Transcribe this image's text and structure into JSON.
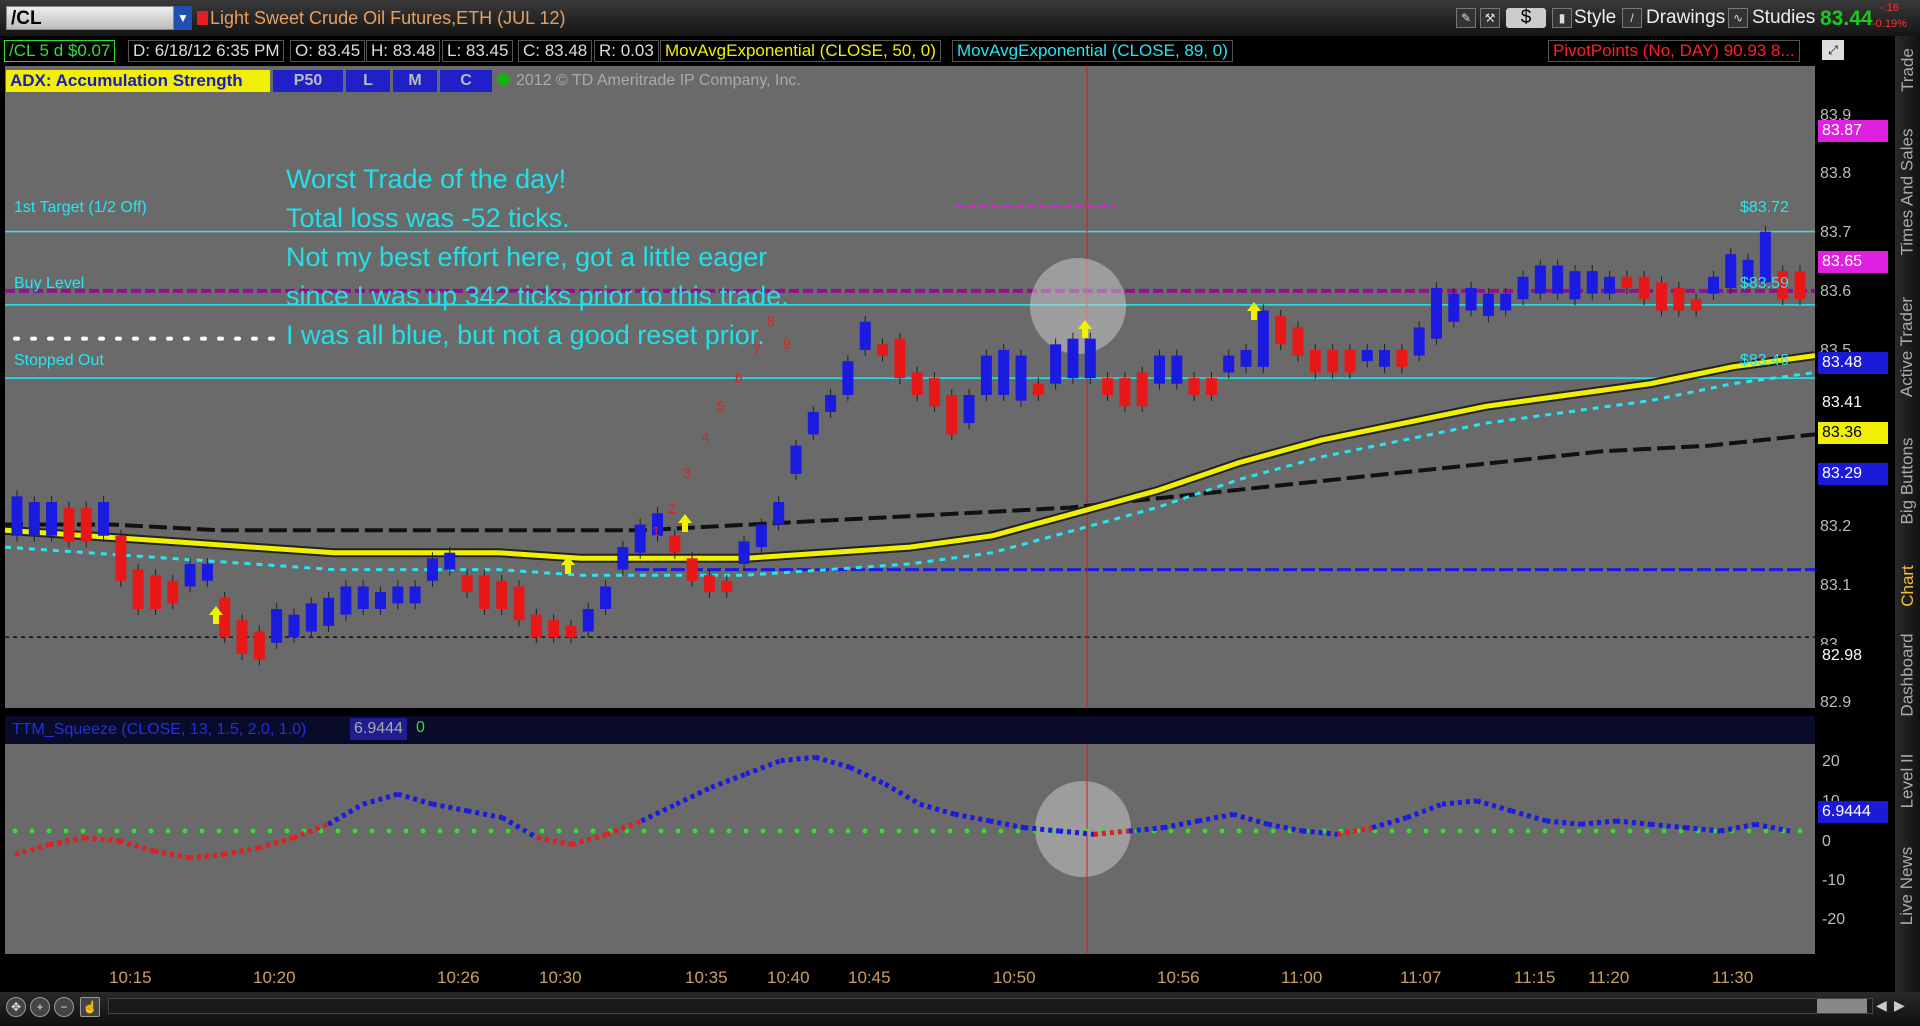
{
  "toolbar": {
    "symbol": "/CL",
    "instrument_title": "Light Sweet Crude Oil Futures,ETH (JUL 12)",
    "dollar_label": "$",
    "style_label": "Style",
    "drawings_label": "Drawings",
    "studies_label": "Studies",
    "last_price": "83.44",
    "net_change": "-.16",
    "pct_change": "-0.19%"
  },
  "infobar": {
    "aggregation": "/CL 5 d $0.07",
    "datetime": "D: 6/18/12 6:35 PM",
    "open": "O: 83.45",
    "high": "H: 83.48",
    "low": "L: 83.45",
    "close": "C: 83.48",
    "range": "R: 0.03",
    "ema50": "MovAvgExponential (CLOSE, 50, 0)",
    "ema89": "MovAvgExponential (CLOSE, 89, 0)",
    "pivots": "PivotPoints (No, DAY)",
    "pivots_val": "90.93",
    "pivots_more": "8..."
  },
  "study_bar": {
    "adx": "ADX:  Accumulation Strength",
    "buttons": [
      "P50",
      "L",
      "M",
      "C"
    ],
    "copyright": "2012 © TD Ameritrade IP Company, Inc."
  },
  "annotation": {
    "lines": [
      "Worst Trade of the day!",
      "Total loss was -52 ticks.",
      "Not my best effort here, got a little eager",
      "since I was up 342 ticks prior to this trade.",
      "I was all blue, but not a good reset prior."
    ]
  },
  "levels": {
    "target": "1st Target (1/2 Off)",
    "buy": "Buy Level",
    "stopped": "Stopped Out",
    "target_price": "$83.72",
    "buy_price": "$83.59",
    "stop_price": "$83.46"
  },
  "price_axis": {
    "ticks": [
      "83.9",
      "83.8",
      "83.7",
      "83.6",
      "83.5",
      "83.2",
      "83.1",
      "83",
      "82.9"
    ],
    "labels": [
      {
        "text": "83.87",
        "bg": "#e020e0",
        "fg": "#ffffff"
      },
      {
        "text": "83.65",
        "bg": "#e020e0",
        "fg": "#ffffff"
      },
      {
        "text": "83.48",
        "bg": "#1a1ad8",
        "fg": "#ffffff"
      },
      {
        "text": "83.41",
        "bg": "#000000",
        "fg": "#ffffff"
      },
      {
        "text": "83.36",
        "bg": "#f0f000",
        "fg": "#000000"
      },
      {
        "text": "83.29",
        "bg": "#1a1ad8",
        "fg": "#ffffff"
      },
      {
        "text": "82.98",
        "bg": "#000000",
        "fg": "#ffffff"
      }
    ]
  },
  "ttm": {
    "label": "TTM_Squeeze (CLOSE, 13, 1.5, 2.0, 1.0)",
    "value": "6.9444",
    "signal": "0",
    "ticks": [
      "20",
      "10",
      "0",
      "-10",
      "-20"
    ],
    "axis_label": "6.9444"
  },
  "time_axis": [
    "10:15",
    "10:20",
    "10:26",
    "10:30",
    "10:35",
    "10:40",
    "10:45",
    "10:50",
    "10:56",
    "11:00",
    "11:07",
    "11:15",
    "11:20",
    "11:30"
  ],
  "sidebar_tabs": [
    "Trade",
    "Times And Sales",
    "Active Trader",
    "Big Buttons",
    "Chart",
    "Dashboard",
    "Level II",
    "Live News"
  ],
  "bar_counts": [
    "1",
    "2",
    "3",
    "4",
    "5",
    "6",
    "7",
    "8",
    "9"
  ],
  "colors": {
    "up": "#1a1ae0",
    "down": "#e81818",
    "ema50": "#f0f000",
    "accent": "#26e6f2"
  },
  "chart_data": {
    "type": "candlestick",
    "title": "Light Sweet Crude Oil Futures,ETH (JUL 12)",
    "ylim": [
      82.86,
      84.0
    ],
    "y_ticks": [
      82.9,
      83.0,
      83.1,
      83.2,
      83.5,
      83.6,
      83.7,
      83.8,
      83.9
    ],
    "x_ticks": [
      "10:15",
      "10:20",
      "10:26",
      "10:30",
      "10:35",
      "10:40",
      "10:45",
      "10:50",
      "10:56",
      "11:00",
      "11:07",
      "11:15",
      "11:20",
      "11:30"
    ],
    "candles": [
      {
        "o": 83.25,
        "c": 83.18,
        "d": "u"
      },
      {
        "o": 83.24,
        "c": 83.18,
        "d": "u"
      },
      {
        "o": 83.24,
        "c": 83.18,
        "d": "u"
      },
      {
        "o": 83.23,
        "c": 83.17,
        "d": "d"
      },
      {
        "o": 83.23,
        "c": 83.17,
        "d": "d"
      },
      {
        "o": 83.24,
        "c": 83.18,
        "d": "u"
      },
      {
        "o": 83.18,
        "c": 83.1,
        "d": "d"
      },
      {
        "o": 83.12,
        "c": 83.05,
        "d": "d"
      },
      {
        "o": 83.11,
        "c": 83.05,
        "d": "d"
      },
      {
        "o": 83.1,
        "c": 83.06,
        "d": "d"
      },
      {
        "o": 83.13,
        "c": 83.09,
        "d": "u"
      },
      {
        "o": 83.13,
        "c": 83.1,
        "d": "u"
      },
      {
        "o": 83.07,
        "c": 83.0,
        "d": "d"
      },
      {
        "o": 83.03,
        "c": 82.97,
        "d": "d"
      },
      {
        "o": 83.01,
        "c": 82.96,
        "d": "d"
      },
      {
        "o": 82.99,
        "c": 83.05,
        "d": "u"
      },
      {
        "o": 83.0,
        "c": 83.04,
        "d": "u"
      },
      {
        "o": 83.01,
        "c": 83.06,
        "d": "u"
      },
      {
        "o": 83.02,
        "c": 83.07,
        "d": "u"
      },
      {
        "o": 83.04,
        "c": 83.09,
        "d": "u"
      },
      {
        "o": 83.05,
        "c": 83.09,
        "d": "u"
      },
      {
        "o": 83.05,
        "c": 83.08,
        "d": "u"
      },
      {
        "o": 83.06,
        "c": 83.09,
        "d": "u"
      },
      {
        "o": 83.06,
        "c": 83.09,
        "d": "u"
      },
      {
        "o": 83.1,
        "c": 83.14,
        "d": "u"
      },
      {
        "o": 83.12,
        "c": 83.15,
        "d": "u"
      },
      {
        "o": 83.11,
        "c": 83.08,
        "d": "d"
      },
      {
        "o": 83.11,
        "c": 83.05,
        "d": "d"
      },
      {
        "o": 83.1,
        "c": 83.05,
        "d": "d"
      },
      {
        "o": 83.09,
        "c": 83.03,
        "d": "d"
      },
      {
        "o": 83.04,
        "c": 83.0,
        "d": "d"
      },
      {
        "o": 83.03,
        "c": 83.0,
        "d": "d"
      },
      {
        "o": 83.02,
        "c": 83.0,
        "d": "d"
      },
      {
        "o": 83.01,
        "c": 83.05,
        "d": "u"
      },
      {
        "o": 83.05,
        "c": 83.09,
        "d": "u"
      },
      {
        "o": 83.12,
        "c": 83.16,
        "d": "u"
      },
      {
        "o": 83.15,
        "c": 83.2,
        "d": "u"
      },
      {
        "o": 83.18,
        "c": 83.22,
        "d": "u"
      },
      {
        "o": 83.18,
        "c": 83.15,
        "d": "d"
      },
      {
        "o": 83.14,
        "c": 83.1,
        "d": "d"
      },
      {
        "o": 83.11,
        "c": 83.08,
        "d": "d"
      },
      {
        "o": 83.1,
        "c": 83.08,
        "d": "d"
      },
      {
        "o": 83.13,
        "c": 83.17,
        "d": "u"
      },
      {
        "o": 83.16,
        "c": 83.2,
        "d": "u"
      },
      {
        "o": 83.2,
        "c": 83.24,
        "d": "u"
      },
      {
        "o": 83.29,
        "c": 83.34,
        "d": "u"
      },
      {
        "o": 83.36,
        "c": 83.4,
        "d": "u"
      },
      {
        "o": 83.4,
        "c": 83.43,
        "d": "u"
      },
      {
        "o": 83.43,
        "c": 83.49,
        "d": "u"
      },
      {
        "o": 83.51,
        "c": 83.56,
        "d": "u"
      },
      {
        "o": 83.52,
        "c": 83.5,
        "d": "d"
      },
      {
        "o": 83.53,
        "c": 83.46,
        "d": "d"
      },
      {
        "o": 83.47,
        "c": 83.43,
        "d": "d"
      },
      {
        "o": 83.46,
        "c": 83.41,
        "d": "d"
      },
      {
        "o": 83.43,
        "c": 83.36,
        "d": "d"
      },
      {
        "o": 83.43,
        "c": 83.38,
        "d": "u"
      },
      {
        "o": 83.43,
        "c": 83.5,
        "d": "u"
      },
      {
        "o": 83.43,
        "c": 83.51,
        "d": "u"
      },
      {
        "o": 83.42,
        "c": 83.5,
        "d": "u"
      },
      {
        "o": 83.45,
        "c": 83.43,
        "d": "d"
      },
      {
        "o": 83.45,
        "c": 83.52,
        "d": "u"
      },
      {
        "o": 83.46,
        "c": 83.53,
        "d": "u"
      },
      {
        "o": 83.46,
        "c": 83.53,
        "d": "u"
      },
      {
        "o": 83.46,
        "c": 83.43,
        "d": "d"
      },
      {
        "o": 83.46,
        "c": 83.41,
        "d": "d"
      },
      {
        "o": 83.47,
        "c": 83.41,
        "d": "d"
      },
      {
        "o": 83.45,
        "c": 83.5,
        "d": "u"
      },
      {
        "o": 83.45,
        "c": 83.5,
        "d": "u"
      },
      {
        "o": 83.46,
        "c": 83.43,
        "d": "d"
      },
      {
        "o": 83.46,
        "c": 83.43,
        "d": "d"
      },
      {
        "o": 83.47,
        "c": 83.5,
        "d": "u"
      },
      {
        "o": 83.48,
        "c": 83.51,
        "d": "u"
      },
      {
        "o": 83.48,
        "c": 83.58,
        "d": "u"
      },
      {
        "o": 83.57,
        "c": 83.52,
        "d": "d"
      },
      {
        "o": 83.55,
        "c": 83.5,
        "d": "d"
      },
      {
        "o": 83.51,
        "c": 83.47,
        "d": "d"
      },
      {
        "o": 83.51,
        "c": 83.47,
        "d": "d"
      },
      {
        "o": 83.51,
        "c": 83.47,
        "d": "d"
      },
      {
        "o": 83.49,
        "c": 83.51,
        "d": "u"
      },
      {
        "o": 83.48,
        "c": 83.51,
        "d": "u"
      },
      {
        "o": 83.51,
        "c": 83.48,
        "d": "d"
      },
      {
        "o": 83.5,
        "c": 83.55,
        "d": "u"
      },
      {
        "o": 83.53,
        "c": 83.62,
        "d": "u"
      },
      {
        "o": 83.56,
        "c": 83.61,
        "d": "u"
      },
      {
        "o": 83.58,
        "c": 83.62,
        "d": "u"
      },
      {
        "o": 83.57,
        "c": 83.61,
        "d": "u"
      },
      {
        "o": 83.58,
        "c": 83.61,
        "d": "u"
      },
      {
        "o": 83.6,
        "c": 83.64,
        "d": "u"
      },
      {
        "o": 83.61,
        "c": 83.66,
        "d": "u"
      },
      {
        "o": 83.61,
        "c": 83.66,
        "d": "u"
      },
      {
        "o": 83.6,
        "c": 83.65,
        "d": "u"
      },
      {
        "o": 83.61,
        "c": 83.65,
        "d": "u"
      },
      {
        "o": 83.61,
        "c": 83.64,
        "d": "u"
      },
      {
        "o": 83.64,
        "c": 83.62,
        "d": "d"
      },
      {
        "o": 83.64,
        "c": 83.6,
        "d": "d"
      },
      {
        "o": 83.63,
        "c": 83.58,
        "d": "d"
      },
      {
        "o": 83.62,
        "c": 83.58,
        "d": "d"
      },
      {
        "o": 83.6,
        "c": 83.58,
        "d": "d"
      },
      {
        "o": 83.61,
        "c": 83.64,
        "d": "u"
      },
      {
        "o": 83.62,
        "c": 83.68,
        "d": "u"
      },
      {
        "o": 83.63,
        "c": 83.67,
        "d": "u"
      },
      {
        "o": 83.63,
        "c": 83.72,
        "d": "u"
      },
      {
        "o": 83.65,
        "c": 83.6,
        "d": "d"
      },
      {
        "o": 83.65,
        "c": 83.6,
        "d": "d"
      }
    ],
    "ema_50": [
      83.19,
      83.18,
      83.17,
      83.16,
      83.15,
      83.15,
      83.15,
      83.14,
      83.14,
      83.14,
      83.15,
      83.16,
      83.18,
      83.22,
      83.26,
      83.31,
      83.35,
      83.38,
      83.41,
      83.43,
      83.45,
      83.48,
      83.5
    ],
    "ema_89": [
      83.2,
      83.2,
      83.19,
      83.19,
      83.19,
      83.19,
      83.19,
      83.2,
      83.21,
      83.22,
      83.23,
      83.25,
      83.27,
      83.29,
      83.31,
      83.33,
      83.34,
      83.36
    ],
    "ttm_squeeze": [
      -7,
      -4,
      -2,
      -3,
      -6,
      -8,
      -7,
      -5,
      -2,
      2,
      8,
      11,
      8,
      6,
      4,
      -2,
      -4,
      -1,
      3,
      8,
      13,
      17,
      21,
      22,
      19,
      14,
      8,
      5,
      3,
      1,
      0,
      -1,
      0,
      1,
      3,
      5,
      2,
      0,
      -1,
      1,
      4,
      8,
      9,
      6,
      3,
      2,
      3,
      2,
      1,
      0,
      2,
      0
    ]
  }
}
